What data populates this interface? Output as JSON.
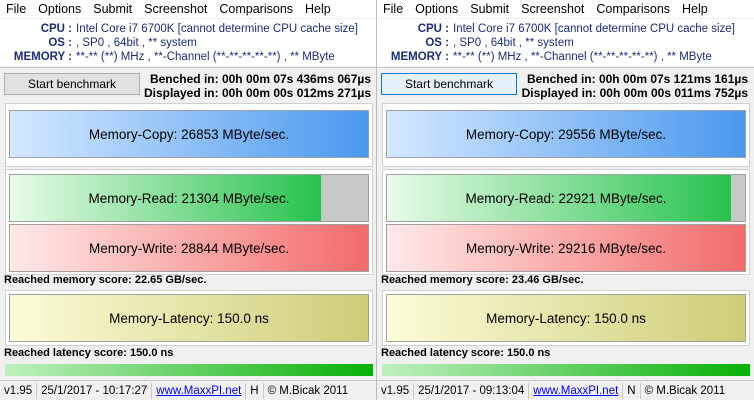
{
  "panes": [
    {
      "menu": [
        "File",
        "Options",
        "Submit",
        "Screenshot",
        "Comparisons",
        "Help"
      ],
      "info": {
        "cpu_label": "CPU :",
        "cpu_value": "Intel Core i7 6700K  [cannot determine CPU cache size]",
        "os_label": "OS :",
        "os_value": ", SP0 , 64bit , ** system",
        "mem_label": "MEMORY :",
        "mem_value": "**-** (**) MHz , **-Channel (**-**-**-**-**) , ** MByte"
      },
      "button_label": "Start benchmark",
      "benched": "Benched in: 00h 00m 07s 436ms 067µs",
      "displayed": "Displayed in: 00h 00m 00s 012ms 271µs",
      "bars": {
        "copy": {
          "text": "Memory-Copy: 26853 MByte/sec.",
          "fill": 1.0
        },
        "read": {
          "text": "Memory-Read: 21304 MByte/sec.",
          "fill": 0.87
        },
        "write": {
          "text": "Memory-Write: 28844 MByte/sec.",
          "fill": 1.0
        },
        "latency": {
          "text": "Memory-Latency: 150.0 ns",
          "fill": 1.0
        }
      },
      "memory_score": "Reached memory score: 22.65 GB/sec.",
      "latency_score": "Reached latency score: 150.0 ns",
      "status": {
        "version": "v1.95",
        "datetime": "25/1/2017 - 10:17:27",
        "link": "www.MaxxPI.net",
        "flag": "H",
        "copyright": "© M.Bicak 2011"
      }
    },
    {
      "menu": [
        "File",
        "Options",
        "Submit",
        "Screenshot",
        "Comparisons",
        "Help"
      ],
      "info": {
        "cpu_label": "CPU :",
        "cpu_value": "Intel Core i7 6700K  [cannot determine CPU cache size]",
        "os_label": "OS :",
        "os_value": ", SP0 , 64bit , ** system",
        "mem_label": "MEMORY :",
        "mem_value": "**-** (**) MHz , **-Channel (**-**-**-**-**) , ** MByte"
      },
      "button_label": "Start benchmark",
      "benched": "Benched in: 00h 00m 07s 121ms 161µs",
      "displayed": "Displayed in: 00h 00m 00s 011ms 752µs",
      "bars": {
        "copy": {
          "text": "Memory-Copy: 29556 MByte/sec.",
          "fill": 1.0
        },
        "read": {
          "text": "Memory-Read: 22921 MByte/sec.",
          "fill": 0.96
        },
        "write": {
          "text": "Memory-Write: 29216 MByte/sec.",
          "fill": 1.0
        },
        "latency": {
          "text": "Memory-Latency: 150.0 ns",
          "fill": 1.0
        }
      },
      "memory_score": "Reached memory score: 23.46 GB/sec.",
      "latency_score": "Reached latency score: 150.0 ns",
      "status": {
        "version": "v1.95",
        "datetime": "25/1/2017 - 09:13:04",
        "link": "www.MaxxPI.net",
        "flag": "N",
        "copyright": "© M.Bicak 2011"
      }
    }
  ],
  "colors": {
    "info_text": "#1c2c7c",
    "copy_bar": "#4a98ee",
    "read_bar": "#27c24e",
    "write_bar": "#f26b6b",
    "latency_bar": "#cdcd78",
    "score_bar": "#08b008"
  }
}
